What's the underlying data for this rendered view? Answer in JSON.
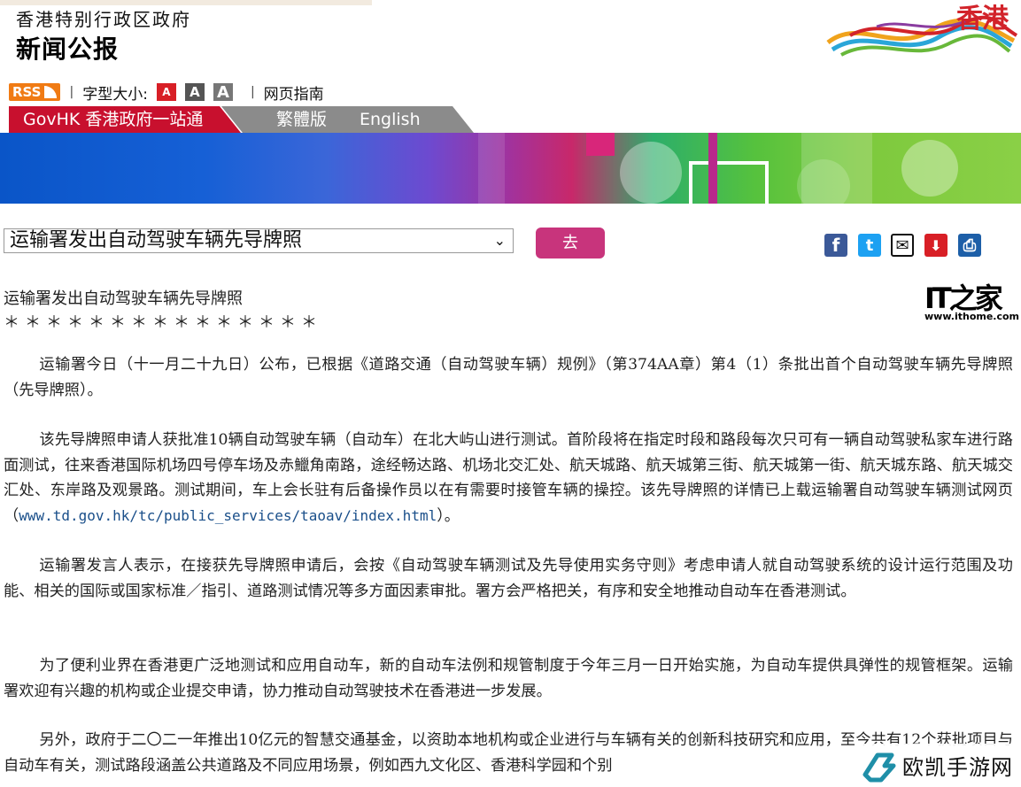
{
  "header": {
    "gov_name": "香港特别行政区政府",
    "press_title": "新闻公报",
    "logo_text": "香港"
  },
  "toolbar": {
    "rss_label": "RSS",
    "font_size_label": "字型大小:",
    "font_small": "A",
    "font_medium": "A",
    "font_large": "A",
    "sitemap_label": "网页指南"
  },
  "tabs": {
    "govhk": "GovHK 香港政府一站通",
    "traditional": "繁體版",
    "english": "English"
  },
  "selector": {
    "selected": "运输署发出自动驾驶车辆先导牌照",
    "go_label": "去"
  },
  "share": {
    "facebook": "f",
    "twitter": "t",
    "email": "✉",
    "download": "⬇",
    "print": "⎙"
  },
  "article": {
    "title": "运输署发出自动驾驶车辆先导牌照",
    "stars": "＊＊＊＊＊＊＊＊＊＊＊＊＊＊＊",
    "p1": "运输署今日（十一月二十九日）公布，已根据《道路交通（自动驾驶车辆）规例》（第374AA章）第4（1）条批出首个自动驾驶车辆先导牌照（先导牌照）。",
    "p2a": "该先导牌照申请人获批准10辆自动驾驶车辆（自动车）在北大屿山进行测试。首阶段将在指定时段和路段每次只可有一辆自动驾驶私家车进行路面测试，往来香港国际机场四号停车场及赤鱲角南路，途经畅达路、机场北交汇处、航天城路、航天城第三街、航天城第一街、航天城东路、航天城交汇处、东岸路及观景路。测试期间，车上会长驻有后备操作员以在有需要时接管车辆的操控。该先导牌照的详情已上载运输署自动驾驶车辆测试网页（",
    "p2_link": "www.td.gov.hk/tc/public_services/taoav/index.html",
    "p2b": "）。",
    "p3": "运输署发言人表示，在接获先导牌照申请后，会按《自动驾驶车辆测试及先导使用实务守则》考虑申请人就自动驾驶系统的设计运行范围及功能、相关的国际或国家标准／指引、道路测试情况等多方面因素审批。署方会严格把关，有序和安全地推动自动车在香港测试。",
    "p4": "为了便利业界在香港更广泛地测试和应用自动车，新的自动车法例和规管制度于今年三月一日开始实施，为自动车提供具弹性的规管框架。运输署欢迎有兴趣的机构或企业提交申请，协力推动自动驾驶技术在香港进一步发展。",
    "p5": "另外，政府于二〇二一年推出10亿元的智慧交通基金，以资助本地机构或企业进行与车辆有关的创新科技研究和应用，至今共有12个获批项目与自动车有关，测试路段涵盖公共道路及不同应用场景，例如西九文化区、香港科学园和个别"
  },
  "overlays": {
    "ithome_logo": "IT之家",
    "ithome_url": "www.ithome.com",
    "watermark_text": "欧凯手游网"
  },
  "colors": {
    "govhk_red": "#c8102e",
    "go_button": "#c8347c",
    "link": "#1a4f8a",
    "rss_orange": "#f07b14"
  }
}
